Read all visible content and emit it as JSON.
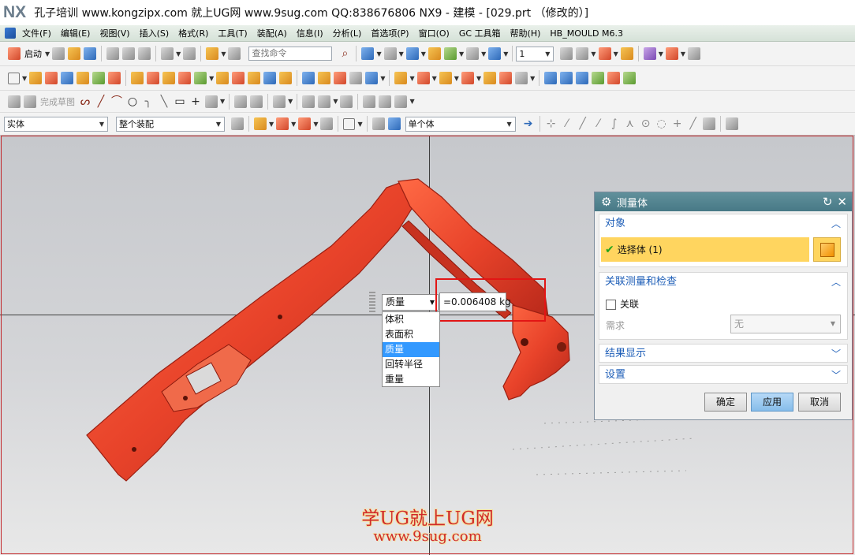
{
  "window": {
    "app_logo": "NX",
    "title": "孔子培训 www.kongzipx.com 就上UG网 www.9sug.com QQ:838676806 NX9 - 建模 - [029.prt （修改的）]"
  },
  "menubar": {
    "items": [
      "文件(F)",
      "编辑(E)",
      "视图(V)",
      "插入(S)",
      "格式(R)",
      "工具(T)",
      "装配(A)",
      "信息(I)",
      "分析(L)",
      "首选项(P)",
      "窗口(O)",
      "GC 工具箱",
      "帮助(H)",
      "HB_MOULD M6.3"
    ]
  },
  "toolbar_standard": {
    "start_label": "启动",
    "command_finder_placeholder": "查找命令",
    "layer_value": "1"
  },
  "toolbar_sketch": {
    "finish_sketch_label": "完成草图"
  },
  "selection_bar": {
    "type_filter": "实体",
    "scope_filter": "整个装配",
    "body_filter": "单个体"
  },
  "measure_widget": {
    "type_selected": "质量",
    "value": "=0.006408 kg",
    "options": [
      "体积",
      "表面积",
      "质量",
      "回转半径",
      "重量"
    ],
    "selected_index": 2
  },
  "dialog": {
    "title": "测量体",
    "section_object": "对象",
    "select_body_label": "选择体 (1)",
    "section_assoc": "关联测量和检查",
    "assoc_checkbox_label": "关联",
    "requirement_label": "需求",
    "requirement_value": "无",
    "section_results": "结果显示",
    "section_settings": "设置",
    "ok_button": "确定",
    "apply_button": "应用",
    "cancel_button": "取消"
  },
  "watermark": {
    "line1": "学UG就上UG网",
    "line2": "www.9sug.com"
  },
  "colors": {
    "part": "#e8432a",
    "dialog_title": "#4d7f8b",
    "selection_highlight": "#ffd55f",
    "callout_box": "#e21515",
    "watermark": "#d02a2a"
  }
}
